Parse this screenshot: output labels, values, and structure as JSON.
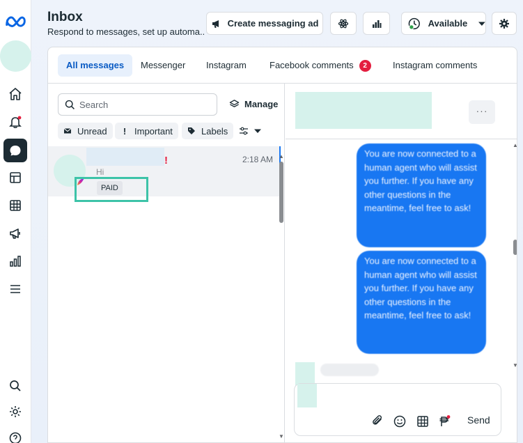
{
  "header": {
    "title": "Inbox",
    "subtitle": "Respond to messages, set up automa...",
    "create_ad_label": "Create messaging ad",
    "status_label": "Available"
  },
  "tabs": [
    {
      "label": "All messages"
    },
    {
      "label": "Messenger"
    },
    {
      "label": "Instagram"
    },
    {
      "label": "Facebook comments",
      "badge": "2"
    },
    {
      "label": "Instagram comments"
    }
  ],
  "list": {
    "search_placeholder": "Search",
    "manage_label": "Manage",
    "filters": [
      "Unread",
      "Important",
      "Labels"
    ],
    "conversations": [
      {
        "time": "2:18 AM",
        "preview": "Hi",
        "tag": "PAID",
        "important_mark": "!"
      }
    ]
  },
  "chat": {
    "more_label": "···",
    "messages": [
      "You are now connected to a human agent who will assist you further. If you have any other questions in the meantime, feel free to ask!",
      "You are now connected to a human agent who will assist you further. If you have any other questions in the meantime, feel free to ask!"
    ],
    "send_label": "Send"
  },
  "colors": {
    "accent": "#1877f2",
    "badge": "#e41e3f",
    "highlight_box": "#3dc3a8",
    "active_tab_bg": "#e7f0fc"
  }
}
